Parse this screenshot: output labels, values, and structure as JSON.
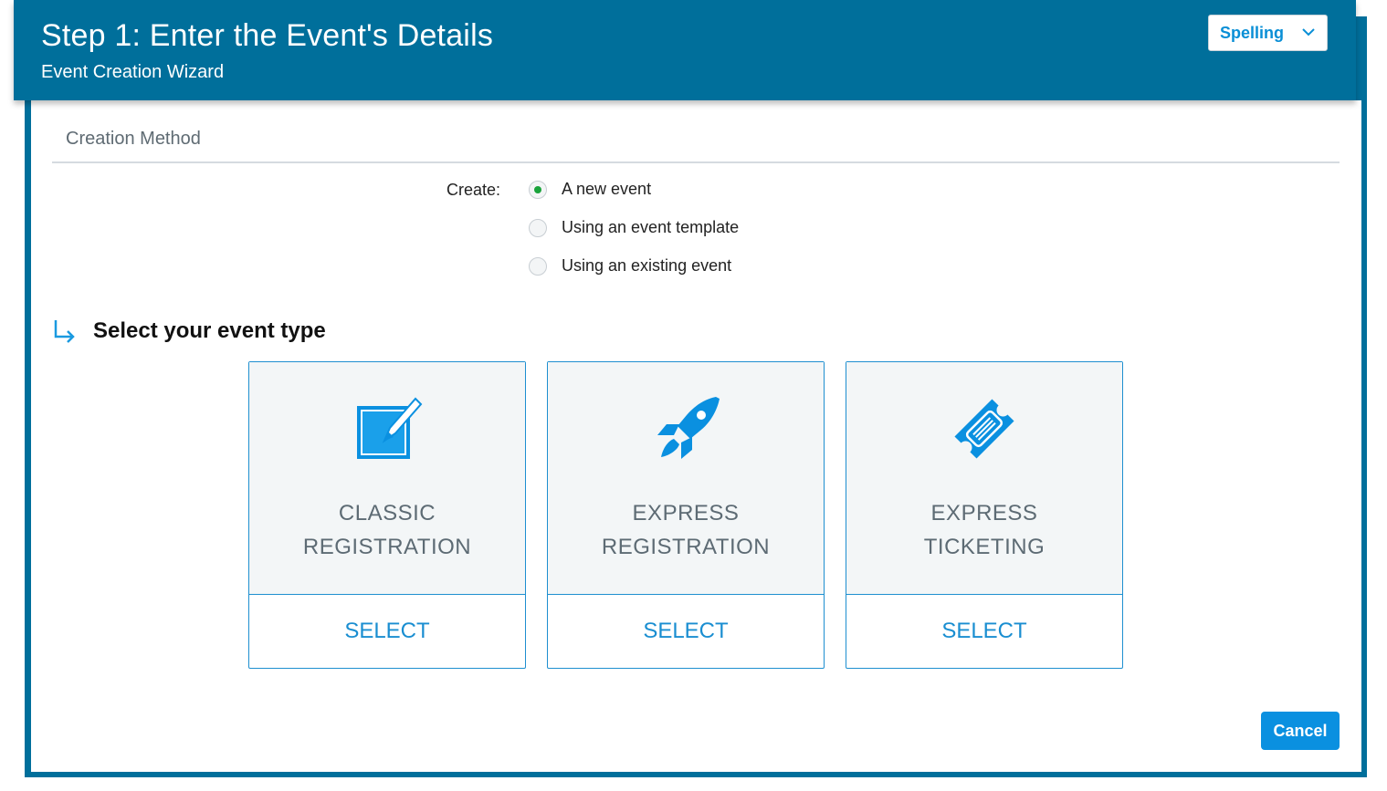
{
  "header": {
    "title": "Step 1: Enter the Event's Details",
    "subtitle": "Event Creation Wizard",
    "spelling_label": "Spelling"
  },
  "creation_method": {
    "section_title": "Creation Method",
    "create_label": "Create:",
    "options": [
      {
        "label": "A new event",
        "checked": true
      },
      {
        "label": "Using an event template",
        "checked": false
      },
      {
        "label": "Using an existing event",
        "checked": false
      }
    ]
  },
  "event_type": {
    "heading": "Select your event type",
    "cards": [
      {
        "name_line1": "CLASSIC",
        "name_line2": "REGISTRATION",
        "select_label": "SELECT",
        "icon": "edit-square-icon"
      },
      {
        "name_line1": "EXPRESS",
        "name_line2": "REGISTRATION",
        "select_label": "SELECT",
        "icon": "rocket-icon"
      },
      {
        "name_line1": "EXPRESS",
        "name_line2": "TICKETING",
        "select_label": "SELECT",
        "icon": "ticket-icon"
      }
    ]
  },
  "footer": {
    "cancel_label": "Cancel"
  },
  "colors": {
    "header_bg": "#006f9b",
    "accent": "#0a90e0",
    "radio_checked": "#1aa33b"
  }
}
